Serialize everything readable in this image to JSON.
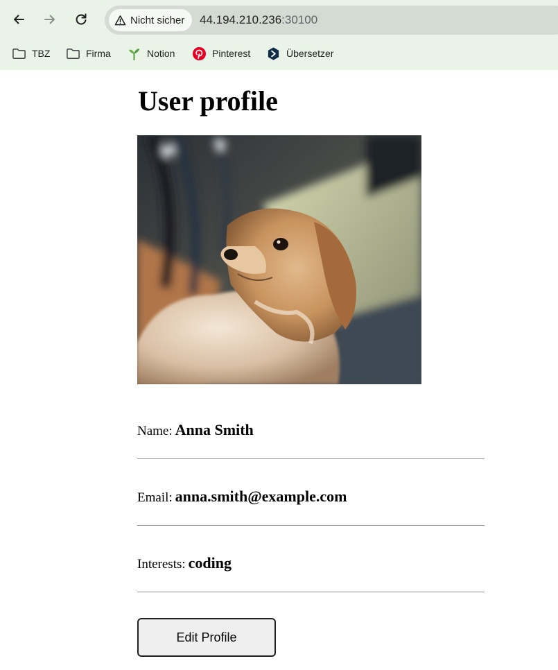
{
  "browser": {
    "security_label": "Nicht sicher",
    "url_host": "44.194.210.236",
    "url_port": ":30100",
    "bookmarks": [
      {
        "label": "TBZ",
        "icon": "folder-icon"
      },
      {
        "label": "Firma",
        "icon": "folder-icon"
      },
      {
        "label": "Notion",
        "icon": "sprout-icon"
      },
      {
        "label": "Pinterest",
        "icon": "pinterest-icon"
      },
      {
        "label": "Übersetzer",
        "icon": "translator-icon"
      }
    ],
    "colors": {
      "chrome": "#e9f3e8",
      "omnibox": "#d3dbd3",
      "pinterest": "#e60023",
      "translator": "#0f2b46"
    }
  },
  "profile": {
    "title": "User profile",
    "photo_alt": "dog",
    "fields": [
      {
        "label": "Name:",
        "value": "Anna Smith"
      },
      {
        "label": "Email:",
        "value": "anna.smith@example.com"
      },
      {
        "label": "Interests:",
        "value": "coding"
      }
    ],
    "edit_button_label": "Edit Profile"
  }
}
